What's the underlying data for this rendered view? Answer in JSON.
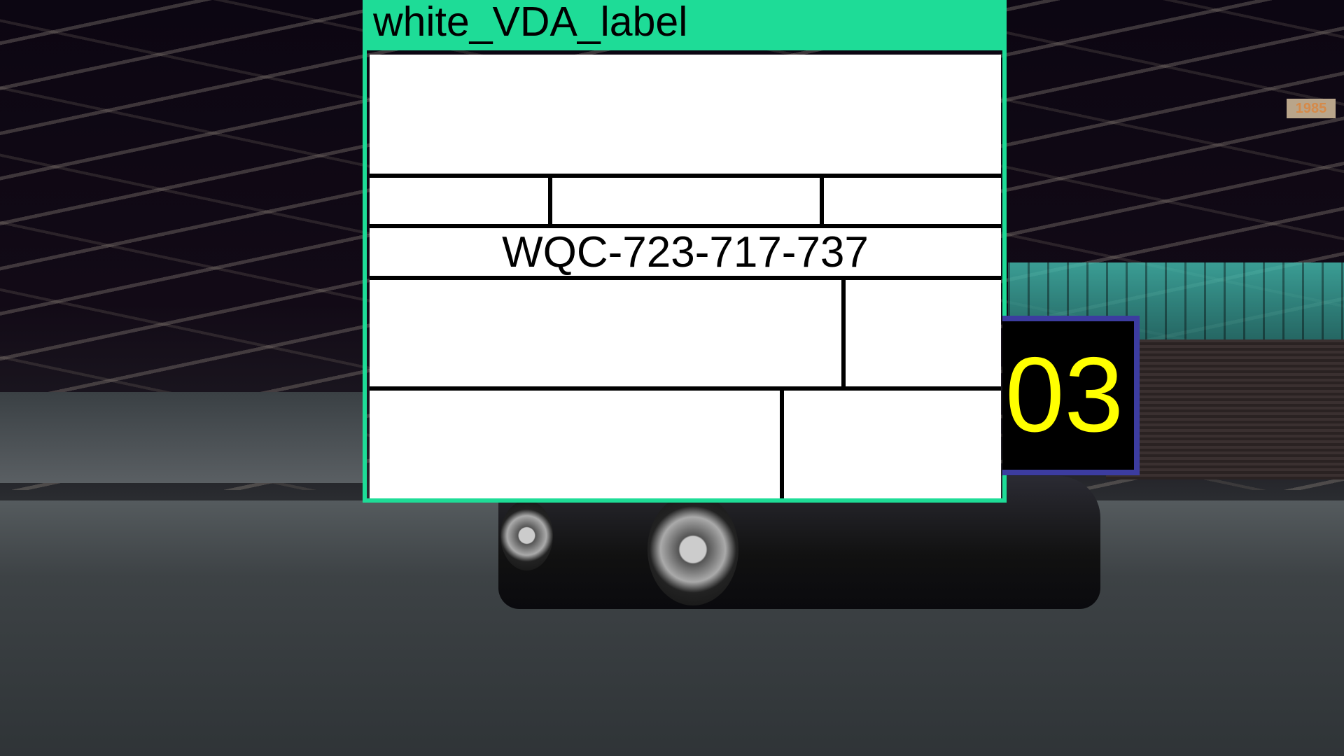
{
  "annotation": {
    "class_label": "white_VDA_label",
    "label_code": "WQC-723-717-737",
    "border_color": "#1edc97"
  },
  "id_box": {
    "number": "03",
    "text_color": "#ffff00",
    "border_color": "#3c3ca0"
  },
  "background": {
    "sign_text": "1985"
  }
}
